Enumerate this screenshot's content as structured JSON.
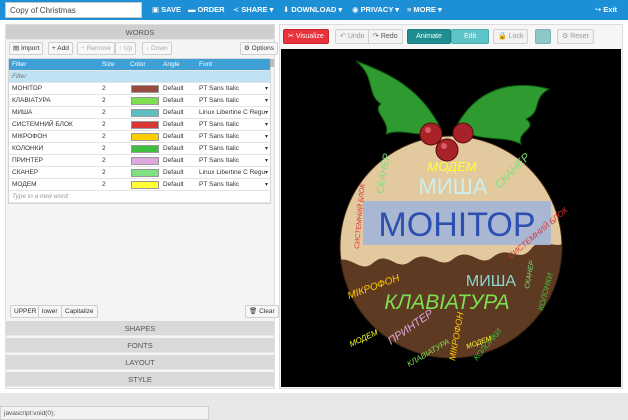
{
  "topbar": {
    "title_value": "Copy of Christmas",
    "menu": {
      "save": "SAVE",
      "order": "ORDER",
      "share": "SHARE",
      "download": "DOWNLOAD",
      "privacy": "PRIVACY",
      "more": "MORE",
      "exit": "Exit"
    },
    "icons": {
      "save": "floppy-icon",
      "order": "cart-icon",
      "share": "share-icon",
      "download": "download-icon",
      "privacy": "eye-icon",
      "more": "menu-icon",
      "exit": "exit-icon"
    }
  },
  "left_panel": {
    "words_header": "WORDS",
    "toolbar": {
      "import": "Import",
      "add": "+ Add",
      "remove": "− Remove",
      "up": "↑ Up",
      "down": "↓ Down",
      "options": "Options"
    },
    "columns": [
      "Filter",
      "Size",
      "Color",
      "Angle",
      "Font"
    ],
    "rows": [
      {
        "word": "МОНІТОР",
        "size": "2",
        "color": "#9b4a3f",
        "angle": "Default",
        "font": "PT Sans Italic"
      },
      {
        "word": "КЛАВІАТУРА",
        "size": "2",
        "color": "#7ee050",
        "angle": "Default",
        "font": "PT Sans Italic"
      },
      {
        "word": "МИША",
        "size": "2",
        "color": "#5dbfbf",
        "angle": "Default",
        "font": "Linux Libertine C Regular"
      },
      {
        "word": "СИСТЕМНИЙ БЛОК",
        "size": "2",
        "color": "#d93636",
        "angle": "Default",
        "font": "PT Sans Italic"
      },
      {
        "word": "МІКРОФОН",
        "size": "2",
        "color": "#ffcc00",
        "angle": "Default",
        "font": "PT Sans Italic"
      },
      {
        "word": "КОЛОНКИ",
        "size": "2",
        "color": "#3dbf3d",
        "angle": "Default",
        "font": "PT Sans Italic"
      },
      {
        "word": "ПРИНТЕР",
        "size": "2",
        "color": "#e0a8e0",
        "angle": "Default",
        "font": "PT Sans Italic"
      },
      {
        "word": "СКАНЕР",
        "size": "2",
        "color": "#7ee07e",
        "angle": "Default",
        "font": "Linux Libertine C Regular"
      },
      {
        "word": "МОДЕМ",
        "size": "2",
        "color": "#ffff33",
        "angle": "Default",
        "font": "PT Sans Italic"
      }
    ],
    "new_word_placeholder": "Type in a new word",
    "case_buttons": {
      "upper": "UPPER",
      "lower": "lower",
      "capitalize": "Capitalize",
      "clear": "Clear"
    },
    "sections": [
      "SHAPES",
      "FONTS",
      "LAYOUT",
      "STYLE"
    ]
  },
  "right_panel": {
    "visualize": "Visualize",
    "undo": "Undo",
    "redo": "Redo",
    "animate": "Animate",
    "edit": "Edit",
    "lock": "Lock",
    "reset": "Reset",
    "colors": {
      "visualize": "#e8333c",
      "animate": "#1f8e91",
      "edit": "#5dc3c7",
      "swatch": "#8fc7c7"
    }
  },
  "cloud": {
    "words": {
      "monitor": "МОНІТОР",
      "keyboard": "КЛАВІАТУРА",
      "mouse": "МИША",
      "system_unit": "СИСТЕМНИЙ БЛОК",
      "microphone": "МІКРОФОН",
      "speakers": "КОЛОНКИ",
      "printer": "ПРИНТЕР",
      "scanner": "СКАНЕР",
      "modem": "МОДЕМ"
    }
  },
  "status_bar": "javascript:void(0);"
}
